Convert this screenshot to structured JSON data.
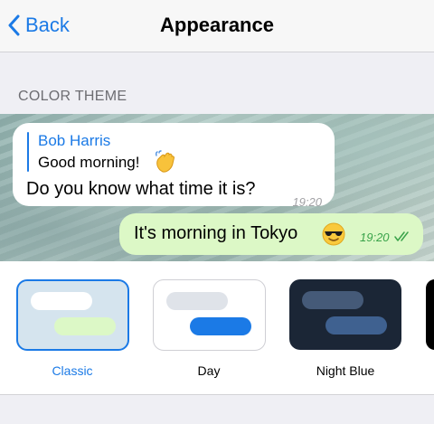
{
  "nav": {
    "back_label": "Back",
    "title": "Appearance"
  },
  "section": {
    "header": "COLOR THEME"
  },
  "preview": {
    "incoming": {
      "reply_name": "Bob Harris",
      "reply_text": "Good morning!",
      "reply_emoji": "waving-hand",
      "text": "Do you know what time it is?",
      "time": "19:20"
    },
    "outgoing": {
      "text": "It's morning in Tokyo",
      "emoji": "smiling-face-with-sunglasses",
      "time": "19:20",
      "status": "read"
    }
  },
  "themes": [
    {
      "label": "Classic",
      "selected": true,
      "background": "#d5e4ee",
      "incoming_color": "#ffffff",
      "outgoing_color": "#dcf8c6"
    },
    {
      "label": "Day",
      "selected": false,
      "background": "#ffffff",
      "incoming_color": "#dfe3e9",
      "outgoing_color": "#1b7ae6"
    },
    {
      "label": "Night Blue",
      "selected": false,
      "background": "#1b2636",
      "incoming_color": "#455a78",
      "outgoing_color": "#3f6190"
    }
  ],
  "colors": {
    "accent": "#1b7ae6",
    "outgoing_bubble": "#dcf8c6",
    "read_check": "#3aa34a"
  }
}
